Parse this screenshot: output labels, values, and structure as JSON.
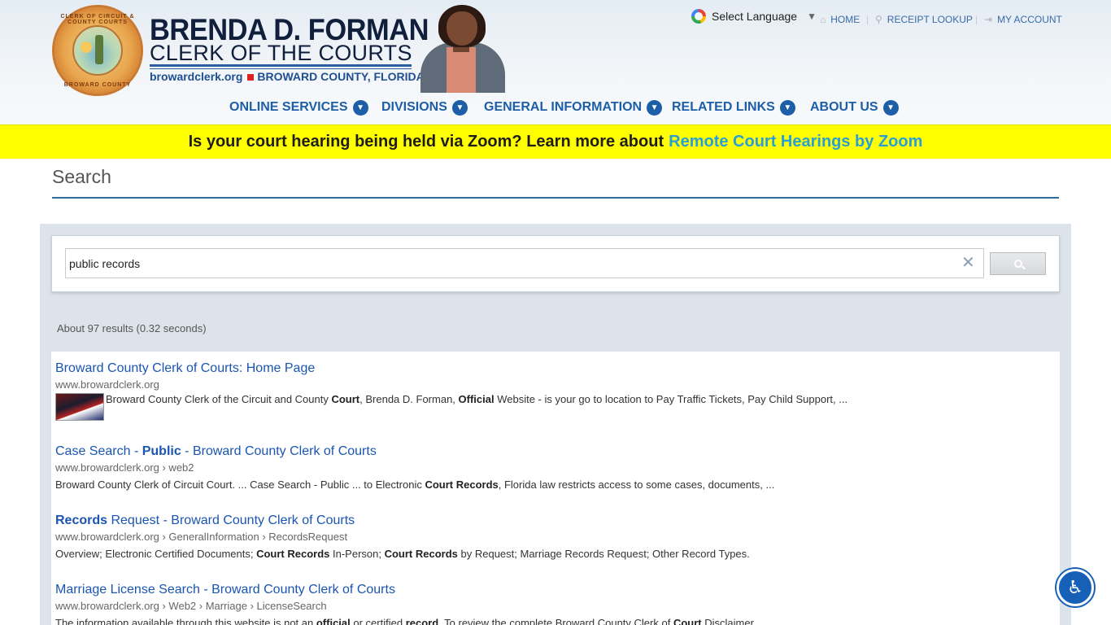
{
  "header": {
    "name": "BRENDA D. FORMAN",
    "subtitle": "CLERK OF THE COURTS",
    "site": "browardclerk.org",
    "county": "BROWARD COUNTY, FLORIDA",
    "seal_top": "CLERK OF CIRCUIT & COUNTY COURTS",
    "seal_bottom": "BROWARD COUNTY"
  },
  "utility": {
    "language": "Select Language",
    "home": "HOME",
    "receipt": "RECEIPT LOOKUP",
    "account": "MY ACCOUNT"
  },
  "nav": {
    "items": [
      "ONLINE SERVICES",
      "DIVISIONS",
      "GENERAL INFORMATION",
      "RELATED LINKS",
      "ABOUT US"
    ]
  },
  "alert": {
    "text": "Is your court hearing being held via Zoom? Learn more about",
    "link": "Remote Court Hearings by Zoom",
    "color": "#ffff00"
  },
  "page": {
    "title": "Search"
  },
  "search": {
    "query": "public records",
    "result_count": "About 97 results (0.32 seconds)"
  },
  "results": [
    {
      "title": "Broward County Clerk of Courts: Home Page",
      "url": "www.browardclerk.org",
      "snippet_parts": [
        "Broward County Clerk of the Circuit and County ",
        "Court",
        ", Brenda D. Forman, ",
        "Official",
        " Website - is your go to location to Pay Traffic Tickets, Pay Child Support, ..."
      ]
    },
    {
      "title_parts": [
        "Case Search - ",
        "Public",
        " - Broward County Clerk of Courts"
      ],
      "url": "www.browardclerk.org › web2",
      "snippet_parts": [
        "Broward County Clerk of Circuit Court. ... Case Search - Public ... to Electronic ",
        "Court Records",
        ", Florida law restricts access to some cases, documents, ..."
      ]
    },
    {
      "title_parts": [
        "Records",
        " Request - Broward County Clerk of Courts"
      ],
      "url": "www.browardclerk.org › GeneralInformation › RecordsRequest",
      "snippet_parts": [
        "Overview; Electronic Certified Documents; ",
        "Court Records",
        " In-Person; ",
        "Court Records",
        " by Request; Marriage Records Request; Other Record Types."
      ]
    },
    {
      "title": "Marriage License Search - Broward County Clerk of Courts",
      "url": "www.browardclerk.org › Web2 › Marriage › LicenseSearch",
      "snippet_parts": [
        "The information available through this website is not an ",
        "official",
        " or certified ",
        "record",
        ". To review the complete Broward County Clerk of ",
        "Court",
        " Disclaimer ..."
      ]
    }
  ]
}
